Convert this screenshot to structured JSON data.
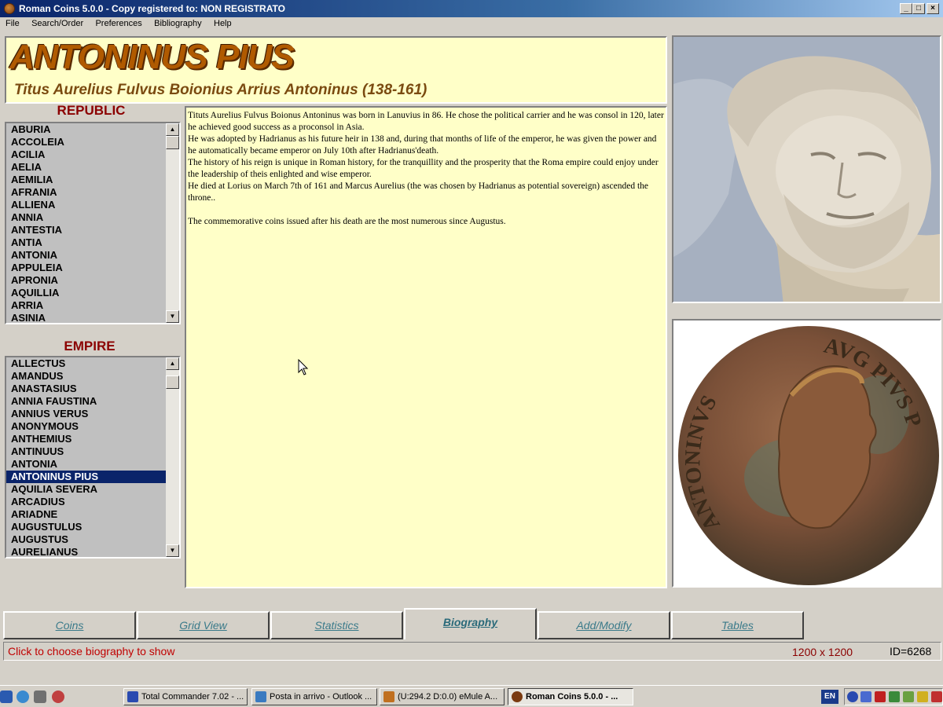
{
  "window": {
    "title": "Roman Coins 5.0.0 - Copy registered to:  NON REGISTRATO",
    "min_glyph": "_",
    "max_glyph": "□",
    "close_glyph": "×"
  },
  "menu": [
    "File",
    "Search/Order",
    "Preferences",
    "Bibliography",
    "Help"
  ],
  "header": {
    "name": "ANTONINUS PIUS",
    "fullname": "Titus Aurelius Fulvus Boionius Arrius Antoninus (138-161)"
  },
  "republic": {
    "label": "REPUBLIC",
    "items": [
      "ABURIA",
      "ACCOLEIA",
      "ACILIA",
      "AELIA",
      "AEMILIA",
      "AFRANIA",
      "ALLIENA",
      "ANNIA",
      "ANTESTIA",
      "ANTIA",
      "ANTONIA",
      "APPULEIA",
      "APRONIA",
      "AQUILLIA",
      "ARRIA",
      "ASINIA"
    ]
  },
  "empire": {
    "label": "EMPIRE",
    "items": [
      "ALLECTUS",
      "AMANDUS",
      "ANASTASIUS",
      "ANNIA FAUSTINA",
      "ANNIUS VERUS",
      "ANONYMOUS",
      "ANTHEMIUS",
      "ANTINUUS",
      "ANTONIA",
      "ANTONINUS PIUS",
      "AQUILIA SEVERA",
      "ARCADIUS",
      "ARIADNE",
      "AUGUSTULUS",
      "AUGUSTUS",
      "AURELIANUS"
    ],
    "selected": "ANTONINUS PIUS"
  },
  "scroll": {
    "up": "▲",
    "down": "▼"
  },
  "biography": {
    "p1": "Tituts Aurelius Fulvus Boionus Antoninus was born in Lanuvius in 86. He chose the political carrier and he was consol in 120, later he achieved good success as a proconsol in Asia.",
    "p2": "He was adopted by Hadrianus as his future heir in 138 and, during that months of life of the emperor, he was given the power and he automatically became emperor on July 10th after Hadrianus'death.",
    "p3": "The history of his reign is unique in Roman history, for the tranquillity and the prosperity that the Roma empire could enjoy under the leadership of theis enlighted and wise emperor.",
    "p4": "He died at Lorius on March 7th of 161 and Marcus Aurelius (the was chosen by Hadrianus as potential sovereign) ascended the throne..",
    "p5": "The commemorative coins issued after his death are the most numerous since Augustus."
  },
  "coin_legend": {
    "left": "ANTONINVS",
    "right": "AVG PIVS P"
  },
  "tabs": [
    {
      "label": "Coins",
      "active": false
    },
    {
      "label": "Grid View",
      "active": false
    },
    {
      "label": "Statistics",
      "active": false
    },
    {
      "label": "Biography",
      "active": true
    },
    {
      "label": "Add/Modify",
      "active": false
    },
    {
      "label": "Tables",
      "active": false
    }
  ],
  "status": {
    "message": "Click to choose biography to show",
    "resolution": "1200 x 1200",
    "id": "ID=6268"
  },
  "taskbar": {
    "tasks": [
      {
        "label": "Total Commander 7.02 - ...",
        "active": false
      },
      {
        "label": "Posta in arrivo - Outlook ...",
        "active": false
      },
      {
        "label": "(U:294.2 D:0.0) eMule A...",
        "active": false
      },
      {
        "label": "Roman Coins 5.0.0 - ...",
        "active": true
      }
    ],
    "lang": "EN"
  },
  "colors": {
    "panel_bg": "#ffffc8",
    "section_label": "#8b0000",
    "selection": "#0a246a",
    "tab_text": "#3a7a8a",
    "status_text": "#c00000"
  }
}
